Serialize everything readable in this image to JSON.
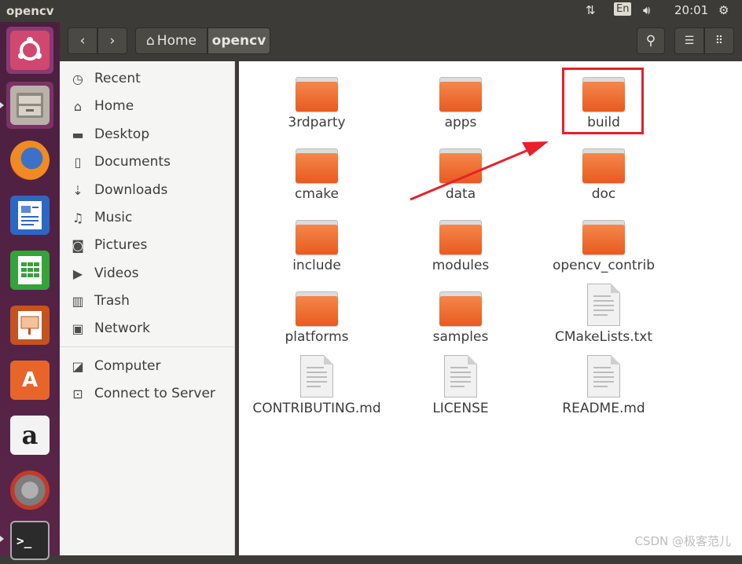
{
  "topbar": {
    "window_title": "opencv",
    "network_icon": "network-updown-icon",
    "language": "En",
    "volume_icon": "volume-icon",
    "clock": "20:01",
    "power_icon": "power-gear-icon"
  },
  "launcher": {
    "items": [
      {
        "name": "ubuntu-dash-icon"
      },
      {
        "name": "files-icon"
      },
      {
        "name": "firefox-icon"
      },
      {
        "name": "writer-icon"
      },
      {
        "name": "calc-icon"
      },
      {
        "name": "impress-icon"
      },
      {
        "name": "software-center-icon"
      },
      {
        "name": "amazon-icon"
      },
      {
        "name": "system-settings-icon"
      },
      {
        "name": "terminal-icon"
      }
    ]
  },
  "header": {
    "back_icon": "chevron-left-icon",
    "forward_icon": "chevron-right-icon",
    "breadcrumb_home": "Home",
    "breadcrumb_current": "opencv",
    "search_icon": "search-icon",
    "list_view_icon": "list-view-icon",
    "grid_view_icon": "grid-view-icon"
  },
  "sidebar": {
    "items": [
      {
        "label": "Recent",
        "icon": "clock-icon"
      },
      {
        "label": "Home",
        "icon": "home-icon"
      },
      {
        "label": "Desktop",
        "icon": "desktop-folder-icon"
      },
      {
        "label": "Documents",
        "icon": "document-icon"
      },
      {
        "label": "Downloads",
        "icon": "download-icon"
      },
      {
        "label": "Music",
        "icon": "music-icon"
      },
      {
        "label": "Pictures",
        "icon": "camera-icon"
      },
      {
        "label": "Videos",
        "icon": "video-icon"
      },
      {
        "label": "Trash",
        "icon": "trash-icon"
      },
      {
        "label": "Network",
        "icon": "network-icon"
      },
      {
        "label": "Computer",
        "icon": "computer-icon"
      },
      {
        "label": "Connect to Server",
        "icon": "server-icon"
      }
    ]
  },
  "files": [
    {
      "label": "3rdparty",
      "type": "folder"
    },
    {
      "label": "apps",
      "type": "folder"
    },
    {
      "label": "build",
      "type": "folder"
    },
    {
      "label": "cmake",
      "type": "folder"
    },
    {
      "label": "data",
      "type": "folder"
    },
    {
      "label": "doc",
      "type": "folder"
    },
    {
      "label": "include",
      "type": "folder"
    },
    {
      "label": "modules",
      "type": "folder"
    },
    {
      "label": "opencv_contrib",
      "type": "folder"
    },
    {
      "label": "platforms",
      "type": "folder"
    },
    {
      "label": "samples",
      "type": "folder"
    },
    {
      "label": "CMakeLists.txt",
      "type": "text"
    },
    {
      "label": "CONTRIBUTING.md",
      "type": "text"
    },
    {
      "label": "LICENSE",
      "type": "text"
    },
    {
      "label": "README.md",
      "type": "text"
    }
  ],
  "annotation": {
    "color": "#e8202a"
  },
  "watermark": "CSDN @极客范儿",
  "colors": {
    "panel": "#3c3b37",
    "launcher": "#5a2549",
    "folder": "#e95a1f",
    "highlight": "#e8202a"
  }
}
